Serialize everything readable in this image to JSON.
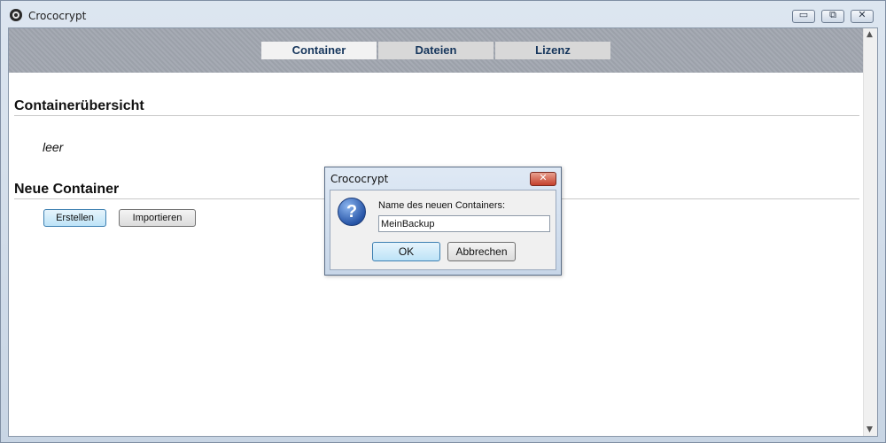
{
  "window": {
    "title": "Crococrypt",
    "controls": {
      "minimize": "▭",
      "maximize": "⧉",
      "close": "✕"
    }
  },
  "nav": {
    "tabs": [
      {
        "label": "Container",
        "active": true
      },
      {
        "label": "Dateien",
        "active": false
      },
      {
        "label": "Lizenz",
        "active": false
      }
    ]
  },
  "main": {
    "overview_heading": "Containerübersicht",
    "overview_empty": "leer",
    "new_heading": "Neue Container",
    "create_label": "Erstellen",
    "import_label": "Importieren"
  },
  "dialog": {
    "title": "Crococrypt",
    "close_glyph": "✕",
    "icon_glyph": "?",
    "prompt": "Name des neuen Containers:",
    "input_value": "MeinBackup",
    "ok_label": "OK",
    "cancel_label": "Abbrechen"
  },
  "colors": {
    "tab_text": "#16365c",
    "primary_button": "#bde3f7",
    "dialog_close": "#c4402c"
  }
}
